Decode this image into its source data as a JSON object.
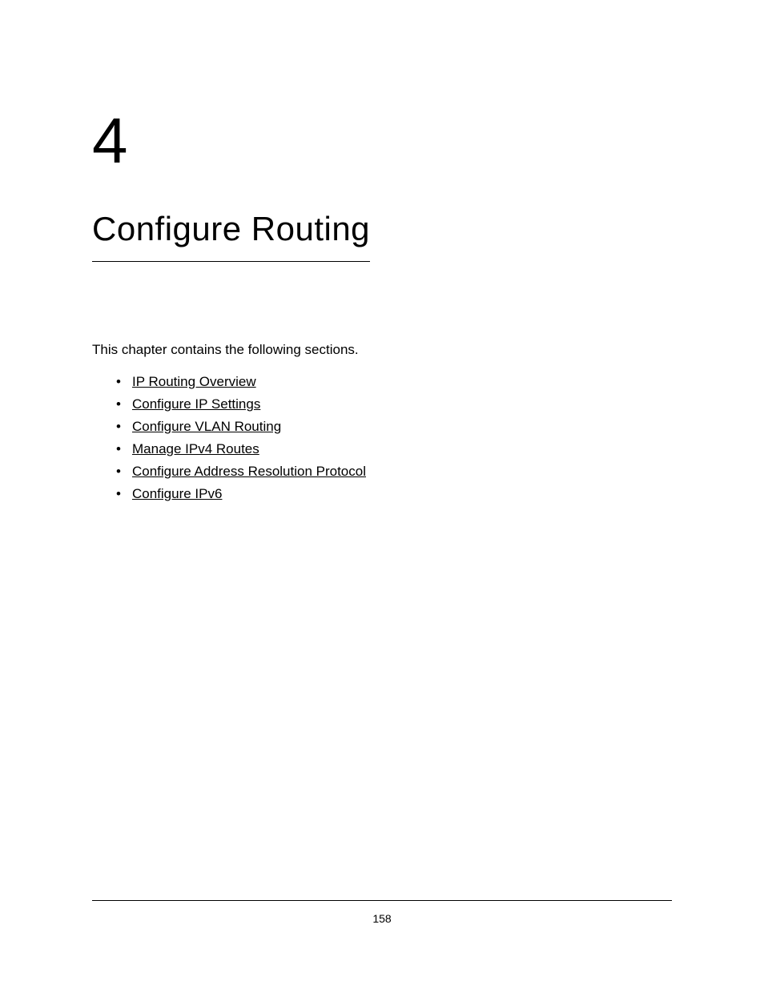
{
  "chapter": {
    "number": "4",
    "title": "Configure Routing"
  },
  "intro": "This chapter contains the following sections.",
  "sections": [
    "IP Routing Overview",
    "Configure IP Settings",
    "Configure VLAN Routing",
    "Manage IPv4 Routes",
    "Configure Address Resolution Protocol",
    "Configure IPv6"
  ],
  "footer": {
    "pageNumber": "158"
  }
}
